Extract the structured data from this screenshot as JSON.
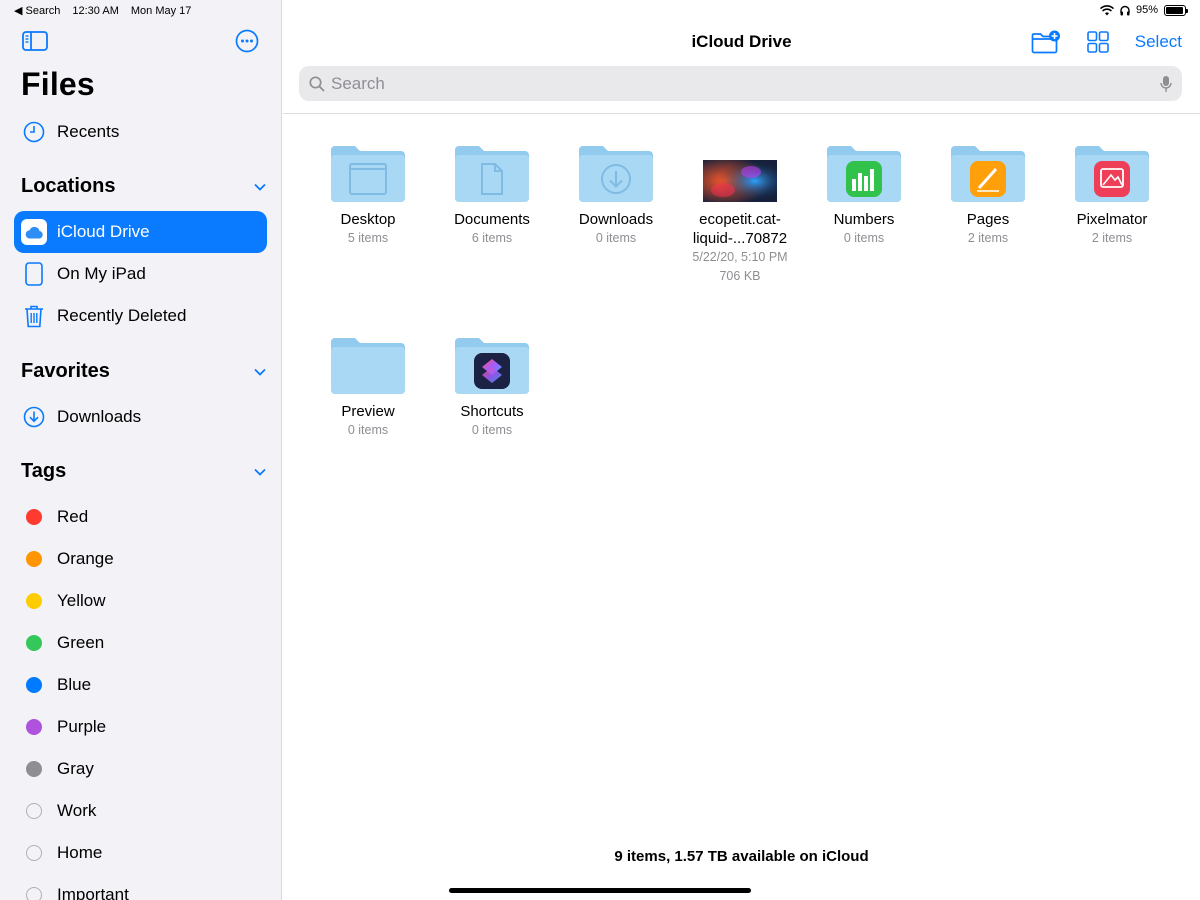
{
  "status": {
    "back_label": "◀ Search",
    "time": "12:30 AM",
    "date": "Mon May 17",
    "battery_text": "95%",
    "battery_level": 0.95
  },
  "sidebar": {
    "title": "Files",
    "recents": "Recents",
    "locations_header": "Locations",
    "locations": [
      "iCloud Drive",
      "On My iPad",
      "Recently Deleted"
    ],
    "favorites_header": "Favorites",
    "favorites": [
      "Downloads"
    ],
    "tags_header": "Tags",
    "tags": [
      {
        "label": "Red",
        "color": "#ff3b30"
      },
      {
        "label": "Orange",
        "color": "#ff9500"
      },
      {
        "label": "Yellow",
        "color": "#ffcc00"
      },
      {
        "label": "Green",
        "color": "#34c759"
      },
      {
        "label": "Blue",
        "color": "#007aff"
      },
      {
        "label": "Purple",
        "color": "#af52de"
      },
      {
        "label": "Gray",
        "color": "#8e8e93"
      },
      {
        "label": "Work",
        "color": ""
      },
      {
        "label": "Home",
        "color": ""
      },
      {
        "label": "Important",
        "color": ""
      }
    ]
  },
  "main": {
    "title": "iCloud Drive",
    "select_label": "Select",
    "search_placeholder": "Search",
    "items": [
      {
        "name": "Desktop",
        "meta": "5 items",
        "icon": "desktop-folder-icon"
      },
      {
        "name": "Documents",
        "meta": "6 items",
        "icon": "documents-folder-icon"
      },
      {
        "name": "Downloads",
        "meta": "0 items",
        "icon": "downloads-folder-icon"
      },
      {
        "name": "ecopetit.cat-\nliquid-...70872",
        "meta": "5/22/20, 5:10 PM",
        "meta2": "706 KB",
        "icon": "image-thumbnail"
      },
      {
        "name": "Numbers",
        "meta": "0 items",
        "icon": "numbers-app-folder-icon"
      },
      {
        "name": "Pages",
        "meta": "2 items",
        "icon": "pages-app-folder-icon"
      },
      {
        "name": "Pixelmator",
        "meta": "2 items",
        "icon": "pixelmator-app-folder-icon"
      },
      {
        "name": "Preview",
        "meta": "0 items",
        "icon": "preview-folder-icon"
      },
      {
        "name": "Shortcuts",
        "meta": "0 items",
        "icon": "shortcuts-app-folder-icon"
      }
    ],
    "footer": "9 items, 1.57 TB available on iCloud"
  },
  "colors": {
    "accent": "#0a7aff",
    "folder": "#a4d5f4",
    "folder_tab": "#93cbef"
  }
}
